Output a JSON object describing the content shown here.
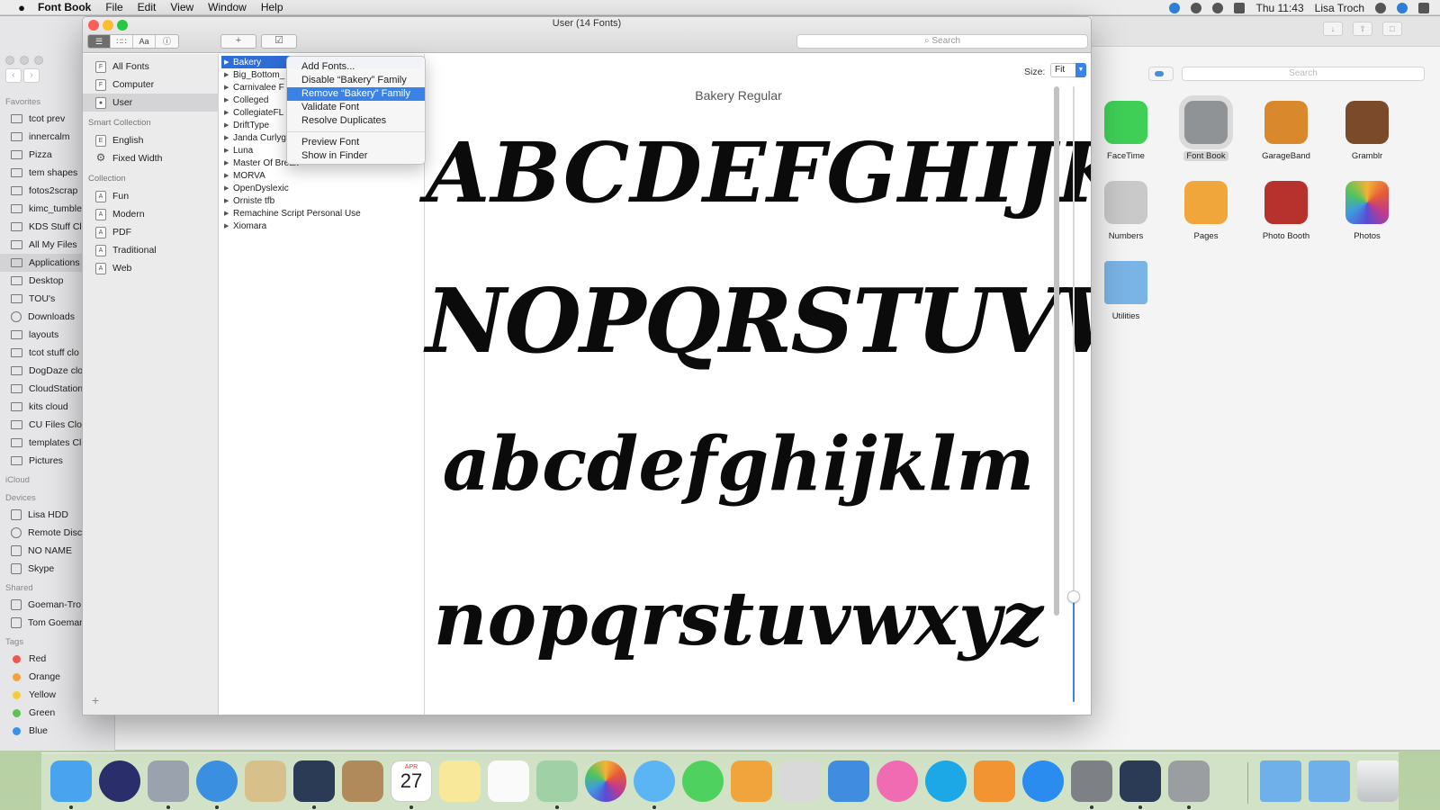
{
  "menubar": {
    "app_name": "Font Book",
    "menus": [
      "File",
      "Edit",
      "View",
      "Window",
      "Help"
    ],
    "clock": "Thu 11:43",
    "user": "Lisa Troch"
  },
  "finder": {
    "sidebar": {
      "favorites_header": "Favorites",
      "favorites": [
        "tcot prev",
        "innercalm",
        "Pizza",
        "tem shapes",
        "fotos2scrap",
        "kimc_tumble",
        "KDS Stuff Cl",
        "All My Files",
        "Applications",
        "Desktop",
        "TOU's",
        "Downloads",
        "layouts",
        "tcot stuff clo",
        "DogDaze clo",
        "CloudStation",
        "kits cloud",
        "CU Files Clo",
        "templates Cl",
        "Pictures"
      ],
      "icloud_header": "iCloud",
      "devices_header": "Devices",
      "devices": [
        "Lisa HDD",
        "Remote Disc",
        "NO NAME",
        "Skype"
      ],
      "shared_header": "Shared",
      "shared": [
        "Goeman-Tro",
        "Tom Goeman"
      ],
      "tags_header": "Tags",
      "tags": [
        {
          "label": "Red",
          "color": "#f0554f"
        },
        {
          "label": "Orange",
          "color": "#f5a03a"
        },
        {
          "label": "Yellow",
          "color": "#f3cd3c"
        },
        {
          "label": "Green",
          "color": "#5cc251"
        },
        {
          "label": "Blue",
          "color": "#3b8eea"
        }
      ]
    },
    "search_placeholder": "Search",
    "apps": [
      {
        "label": "FaceTime",
        "color": "#3fcf57"
      },
      {
        "label": "Font Book",
        "color": "#8f9396"
      },
      {
        "label": "GarageBand",
        "color": "#d9892b"
      },
      {
        "label": "Gramblr",
        "color": "#7a4a2a"
      },
      {
        "label": "Numbers",
        "color": "#c9c9c9"
      },
      {
        "label": "Pages",
        "color": "#f1a63c"
      },
      {
        "label": "Photo Booth",
        "color": "#b8322d"
      },
      {
        "label": "Photos",
        "color": "#f3f3f3"
      },
      {
        "label": "Utilities",
        "color": "#7ab4e6"
      }
    ]
  },
  "fontbook": {
    "window_title": "User (14 Fonts)",
    "search_placeholder": "Search",
    "library": {
      "top_items": [
        "All Fonts",
        "Computer",
        "User"
      ],
      "smart_header": "Smart Collection",
      "smart_items": [
        "English",
        "Fixed Width"
      ],
      "collection_header": "Collection",
      "collection_items": [
        "Fun",
        "Modern",
        "PDF",
        "Traditional",
        "Web"
      ]
    },
    "fonts": [
      "Bakery",
      "Big_Bottom_",
      "Carnivalee F",
      "Colleged",
      "CollegiateFL",
      "DriftType",
      "Janda Curlyg",
      "Luna",
      "Master Of Break",
      "MORVA",
      "OpenDyslexic",
      "Orniste tfb",
      "Remachine Script Personal Use",
      "Xiomara"
    ],
    "context_menu": {
      "items": [
        "Add Fonts...",
        "Disable “Bakery” Family",
        "Remove “Bakery” Family",
        "Validate Font",
        "Resolve Duplicates"
      ],
      "items2": [
        "Preview Font",
        "Show in Finder"
      ]
    },
    "preview": {
      "size_label": "Size:",
      "size_value": "Fit",
      "title": "Bakery Regular",
      "upper1": "ABCDEFGHIJKLM",
      "upper2": "NOPQRSTUVWXYZ",
      "lower1": "abcdefghijklm",
      "lower2": "nopqrstuvwxyz"
    }
  },
  "dock": {
    "apps": [
      "finder",
      "siri",
      "launchpad",
      "safari",
      "mail",
      "affinity-photo",
      "contacts",
      "calendar",
      "notes",
      "reminders",
      "maps",
      "photos",
      "messages",
      "facetime",
      "pages",
      "numbers",
      "keynote",
      "itunes",
      "skype",
      "ibooks",
      "app-store",
      "system-preferences",
      "affinity-photo-2",
      "font-book"
    ],
    "calendar_month": "APR",
    "calendar_day": "27",
    "stacks": [
      "applications-folder",
      "documents-folder",
      "trash"
    ]
  },
  "colors": {
    "selection": "#2e6cd6",
    "menu_highlight": "#3b82e6",
    "close": "#fc5f57",
    "minimize": "#fdbc2e",
    "zoom": "#28c840"
  }
}
